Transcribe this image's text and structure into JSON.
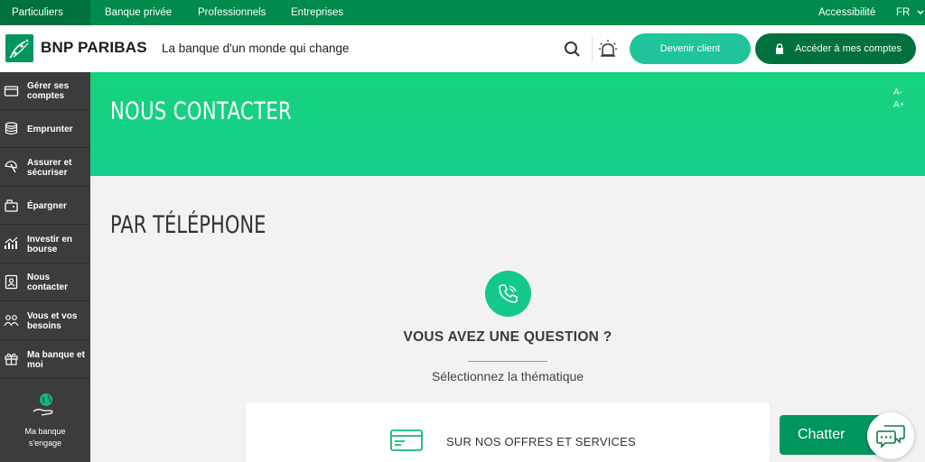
{
  "topnav": {
    "items": [
      "Particuliers",
      "Banque privée",
      "Professionnels",
      "Entreprises"
    ],
    "accessibility": "Accessibilité",
    "language": "FR"
  },
  "header": {
    "brand": "BNP PARIBAS",
    "tagline": "La banque d'un monde qui change",
    "search_icon": "search-icon",
    "alert_icon": "siren-icon",
    "become_client": "Devenir client",
    "access_accounts": "Accéder à mes comptes"
  },
  "sidebar": {
    "items": [
      {
        "label": "Gérer ses comptes",
        "icon": "wallet-icon"
      },
      {
        "label": "Emprunter",
        "icon": "coins-icon"
      },
      {
        "label": "Assurer et sécuriser",
        "icon": "umbrella-icon"
      },
      {
        "label": "Épargner",
        "icon": "piggy-bank-icon"
      },
      {
        "label": "Investir en bourse",
        "icon": "chart-icon"
      },
      {
        "label": "Nous contacter",
        "icon": "contact-icon"
      },
      {
        "label": "Vous et vos besoins",
        "icon": "people-icon"
      },
      {
        "label": "Ma banque et moi",
        "icon": "gift-icon"
      }
    ],
    "promo": "Ma banque s'engage"
  },
  "banner": {
    "title": "NOUS CONTACTER",
    "font_decrease": "A-",
    "font_increase": "A+"
  },
  "main": {
    "section_title": "PAR TÉLÉPHONE",
    "question": "VOUS AVEZ UNE QUESTION ?",
    "select_prompt": "Sélectionnez la thématique",
    "card_label": "SUR NOS OFFRES ET SERVICES"
  },
  "chat": {
    "label": "Chatter"
  },
  "colors": {
    "brand_green": "#008a4b",
    "accent_mint": "#1fc49a",
    "dark_green": "#00713d",
    "sidebar_bg": "#3c3c3c"
  }
}
